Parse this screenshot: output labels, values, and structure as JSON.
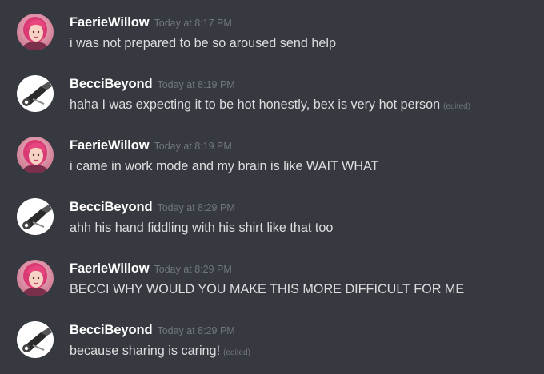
{
  "messages": [
    {
      "username": "FaerieWillow",
      "avatar": "faeriewillow-avatar",
      "timestamp": "Today at 8:17 PM",
      "text": "i was not prepared to be so aroused send help",
      "edited": ""
    },
    {
      "username": "BecciBeyond",
      "avatar": "beccibeyond-avatar",
      "timestamp": "Today at 8:19 PM",
      "text": "haha I was expecting it to be hot honestly, bex is very hot person",
      "edited": "(edited)"
    },
    {
      "username": "FaerieWillow",
      "avatar": "faeriewillow-avatar",
      "timestamp": "Today at 8:19 PM",
      "text": "i came in work mode and my brain is like WAIT WHAT",
      "edited": ""
    },
    {
      "username": "BecciBeyond",
      "avatar": "beccibeyond-avatar",
      "timestamp": "Today at 8:29 PM",
      "text": "ahh his hand fiddling with his shirt like that too",
      "edited": ""
    },
    {
      "username": "FaerieWillow",
      "avatar": "faeriewillow-avatar",
      "timestamp": "Today at 8:29 PM",
      "text": "BECCI WHY WOULD YOU MAKE THIS MORE DIFFICULT FOR ME",
      "edited": ""
    },
    {
      "username": "BecciBeyond",
      "avatar": "beccibeyond-avatar",
      "timestamp": "Today at 8:29 PM",
      "text": "because sharing is caring!",
      "edited": "(edited)"
    }
  ],
  "colors": {
    "background": "#36393f",
    "username": "#ffffff",
    "text": "#dcddde",
    "muted": "#72767d",
    "faerie_hair": "#e0407a"
  }
}
